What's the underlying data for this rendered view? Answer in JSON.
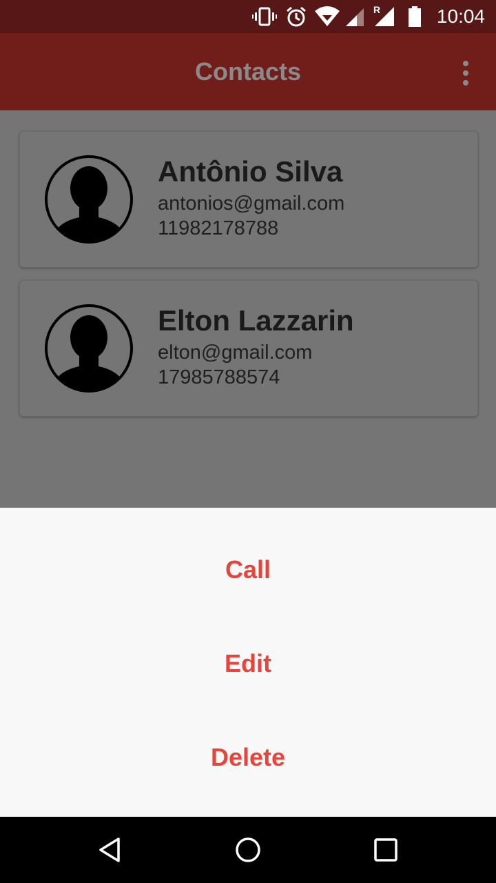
{
  "status_bar": {
    "time": "10:04",
    "icons": [
      "vibrate-icon",
      "alarm-icon",
      "wifi-icon",
      "signal-icon",
      "roaming-signal-icon",
      "battery-icon"
    ],
    "roaming_label": "R"
  },
  "app_bar": {
    "title": "Contacts",
    "menu_icon": "more-vert-icon"
  },
  "contacts": [
    {
      "name": "Antônio Silva",
      "email": "antonios@gmail.com",
      "phone": "11982178788",
      "avatar_icon": "person-avatar-icon"
    },
    {
      "name": "Elton Lazzarin",
      "email": "elton@gmail.com",
      "phone": "17985788574",
      "avatar_icon": "person-avatar-icon"
    }
  ],
  "bottom_sheet": {
    "actions": [
      "Call",
      "Edit",
      "Delete"
    ]
  },
  "nav_bar": {
    "buttons": [
      "back-icon",
      "home-icon",
      "recents-icon"
    ]
  },
  "colors": {
    "status_bar": "#561716",
    "app_bar": "#711e1b",
    "scrim": "#757575",
    "action_text": "#e5453a",
    "sheet_bg": "#f8f8f8"
  }
}
